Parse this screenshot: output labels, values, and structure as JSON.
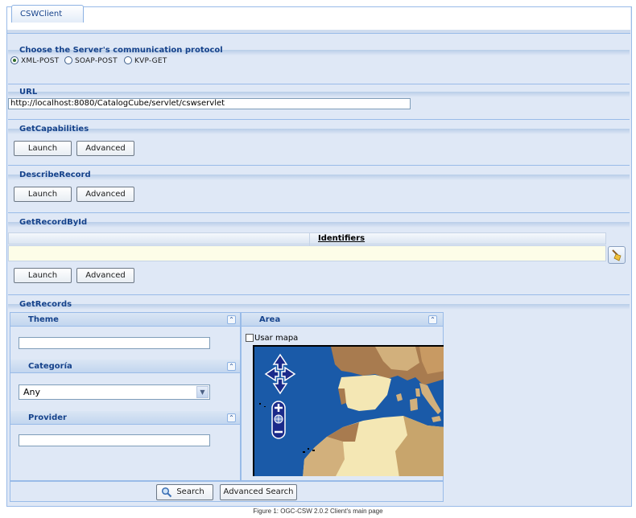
{
  "window": {
    "tab_label": "CSWClient"
  },
  "protocol": {
    "heading": "Choose the Server's communication protocol",
    "options": [
      {
        "label": "XML-POST",
        "selected": true
      },
      {
        "label": "SOAP-POST",
        "selected": false
      },
      {
        "label": "KVP-GET",
        "selected": false
      }
    ]
  },
  "url": {
    "heading": "URL",
    "value": "http://localhost:8080/CatalogCube/servlet/cswservlet"
  },
  "get_capabilities": {
    "heading": "GetCapabilities",
    "launch_label": "Launch",
    "advanced_label": "Advanced"
  },
  "describe_record": {
    "heading": "DescribeRecord",
    "launch_label": "Launch",
    "advanced_label": "Advanced"
  },
  "get_record_by_id": {
    "heading": "GetRecordById",
    "grid_column": "Identifiers",
    "launch_label": "Launch",
    "advanced_label": "Advanced"
  },
  "get_records": {
    "heading": "GetRecords",
    "theme": {
      "title": "Theme",
      "value": ""
    },
    "categoria": {
      "title": "Categoría",
      "selected": "Any"
    },
    "provider": {
      "title": "Provider",
      "value": ""
    },
    "area": {
      "title": "Area",
      "use_map_label": "Usar mapa",
      "use_map_checked": false
    },
    "search_label": "Search",
    "advanced_search_label": "Advanced Search"
  },
  "caption": "Figure 1: OGC-CSW 2.0.2 Client's main page",
  "colors": {
    "panel_bg": "#dfe8f6",
    "header_text": "#15428b",
    "sea": "#1a5aa8",
    "land_dark": "#a87b4f",
    "land_light": "#f4e7b4",
    "land_mid": "#d2b07c"
  }
}
